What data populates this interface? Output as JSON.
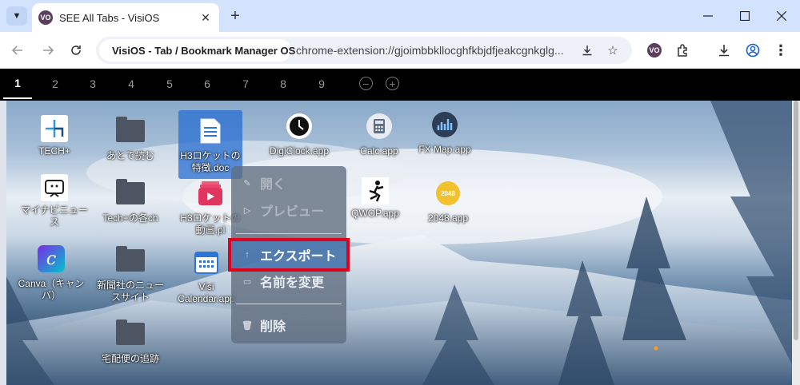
{
  "browser": {
    "tab_title": "SEE All Tabs - VisiOS",
    "favicon_text": "VO",
    "chip_label": "VisiOS - Tab / Bookmark Manager OS",
    "url": "chrome-extension://gjoimbbkllocghfkbjdfjeakcgnkglg..."
  },
  "desktop_tabs": [
    "1",
    "2",
    "3",
    "4",
    "5",
    "6",
    "7",
    "8",
    "9"
  ],
  "desktop_buttons": {
    "remove": "−",
    "add": "+"
  },
  "icons": {
    "tech": "TECH+",
    "later": "あとで読む",
    "h3doc": "H3ロケットの特徴.doc",
    "digiclock": "DigiClock.app",
    "calc": "Calc.app",
    "fxmap": "FX Map.app",
    "mynavi": "マイナビニュース",
    "techch": "Tech+の各ch",
    "h3video": "H3ロケットの動画.pl",
    "qwop": "QWOP.app",
    "game2048": "2048.app",
    "game2048_text": "2048",
    "canva": "Canva（キャンバ）",
    "news": "新聞社のニュースサイト",
    "calendar": "Visi Calendar.app",
    "delivery": "宅配便の追跡"
  },
  "context_menu": {
    "open": "開く",
    "preview": "プレビュー",
    "export": "エクスポート",
    "rename": "名前を変更",
    "delete": "削除"
  },
  "colors": {
    "highlight_outline": "#e0001b",
    "selected_icon": "#286ed2"
  }
}
